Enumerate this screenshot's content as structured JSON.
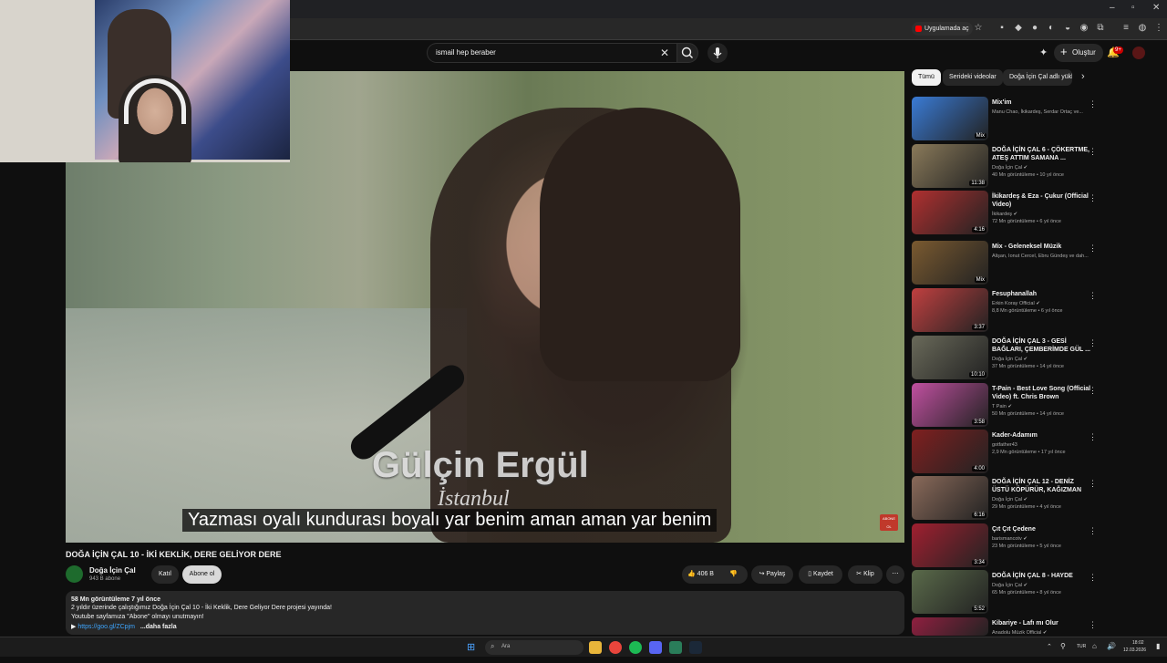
{
  "browser": {
    "open_in_app_label": "Uygulamada aç"
  },
  "masthead": {
    "search_value": "ismail hep beraber",
    "create_label": "Oluştur",
    "notification_count": "9+"
  },
  "player": {
    "overlay_title": "Gülçin Ergül",
    "overlay_subtitle": "İstanbul",
    "caption": "Yazması oyalı kundurası boyalı yar benim aman aman yar benim",
    "watermark": "ABONE OL"
  },
  "video": {
    "title": "DOĞA İÇİN ÇAL 10 - İKİ KEKLİK, DERE GELİYOR DERE",
    "channel_name": "Doğa İçin Çal",
    "channel_subs": "943 B abone",
    "join_label": "Katıl",
    "subscribe_label": "Abone ol",
    "like_count": "406 B",
    "share_label": "Paylaş",
    "save_label": "Kaydet",
    "clip_label": "Klip"
  },
  "description": {
    "stats": "58 Mn görüntüleme  7 yıl önce",
    "line1": "2 yıldır üzerinde çalıştığımız Doğa İçin Çal 10 - İki Keklik, Dere Geliyor Dere projesi yayında!",
    "line2": "Youtube sayfamıza \"Abone\" olmayı unutmayın!",
    "link": "https://goo.gl/ZCpjm",
    "more": "...daha fazla"
  },
  "sidebar": {
    "chips": [
      "Tümü",
      "Serideki videolar",
      "Doğa İçin Çal adlı yükl"
    ],
    "recommendations": [
      {
        "title": "Mix'im",
        "meta1": "Manu Chao, İkikardeş, Serdar Ortaç ve...",
        "meta2": "",
        "duration": "Mix",
        "color": "#3a7bd5"
      },
      {
        "title": "DOĞA İÇİN ÇAL 6 - ÇÖKERTME, ATEŞ ATTIM SAMANA ...",
        "meta1": "Doğa İçin Çal ✔",
        "meta2": "40 Mn görüntüleme • 10 yıl önce",
        "duration": "11:38",
        "color": "#8a7a5a"
      },
      {
        "title": "İkikardeş & Eza - Çukur (Official Video)",
        "meta1": "İkikardeş ✔",
        "meta2": "72 Mn görüntüleme • 6 yıl önce",
        "duration": "4:16",
        "color": "#b03030"
      },
      {
        "title": "Mix - Geleneksel Müzik",
        "meta1": "Alişan, Ionut Cercel, Ebru Gündeş ve dah...",
        "meta2": "",
        "duration": "Mix",
        "color": "#7a5a30"
      },
      {
        "title": "Fesuphanallah",
        "meta1": "Erkin Koray Official ✔",
        "meta2": "8,8 Mn görüntüleme • 6 yıl önce",
        "duration": "3:37",
        "color": "#c04040"
      },
      {
        "title": "DOĞA İÇİN ÇAL 3 - GESİ BAĞLARI, ÇEMBERİMDE GÜL ...",
        "meta1": "Doğa İçin Çal ✔",
        "meta2": "37 Mn görüntüleme • 14 yıl önce",
        "duration": "10:10",
        "color": "#6a6a5a"
      },
      {
        "title": "T-Pain - Best Love Song (Official Video) ft. Chris Brown",
        "meta1": "T Pain ✔",
        "meta2": "50 Mn görüntüleme • 14 yıl önce",
        "duration": "3:58",
        "color": "#c050a0"
      },
      {
        "title": "Kader-Adamım",
        "meta1": "gotfather43",
        "meta2": "2,9 Mn görüntüleme • 17 yıl önce",
        "duration": "4:00",
        "color": "#802020"
      },
      {
        "title": "DOĞA İÇİN ÇAL 12 - DENİZ ÜSTÜ KÖPÜRÜR, KAĞIZMAN",
        "meta1": "Doğa İçin Çal ✔",
        "meta2": "29 Mn görüntüleme • 4 yıl önce",
        "duration": "6:16",
        "color": "#8a6a5a"
      },
      {
        "title": "Çıt Çıt Çedene",
        "meta1": "barismancotv ✔",
        "meta2": "23 Mn görüntüleme • 5 yıl önce",
        "duration": "3:34",
        "color": "#a02030"
      },
      {
        "title": "DOĞA İÇİN ÇAL 8 - HAYDE",
        "meta1": "Doğa İçin Çal ✔",
        "meta2": "65 Mn görüntüleme • 8 yıl önce",
        "duration": "5:52",
        "color": "#5a6a4a"
      },
      {
        "title": "Kibariye - Lafı mı Olur",
        "meta1": "Anadolu Müzik Official ✔",
        "meta2": "",
        "duration": "",
        "color": "#902040"
      }
    ]
  },
  "taskbar": {
    "search_placeholder": "Ara",
    "language": "TUR",
    "time": "18:02",
    "date": "12.03.2026"
  },
  "colors": {
    "background": "#0f0f0f",
    "youtube_red": "#ff0000",
    "link": "#3ea6ff"
  }
}
